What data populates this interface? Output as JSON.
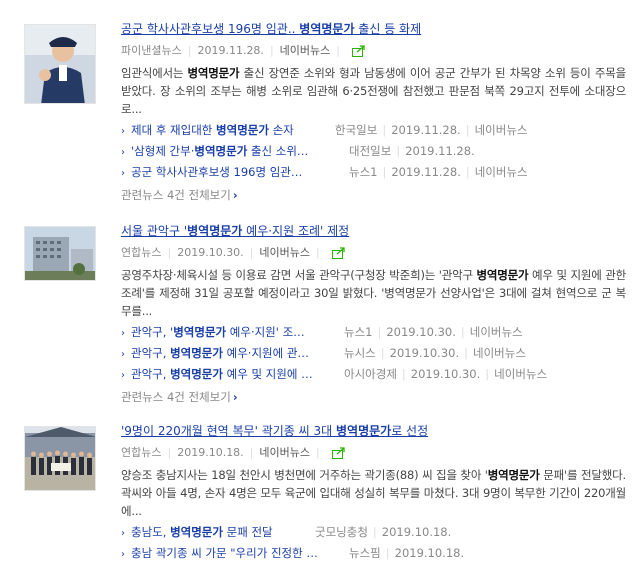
{
  "colors": {
    "link": "#1a3ea8",
    "meta": "#888888",
    "share": "#2db400"
  },
  "articles": [
    {
      "title_pre": "공군 학사사관후보생 196명 임관.. ",
      "title_hl": "병역명문가",
      "title_post": " 출신 등 화제",
      "source": "파이낸셜뉴스",
      "date": "2019.11.28.",
      "naver": "네이버뉴스",
      "desc_a": "임관식에서는 ",
      "desc_hl": "병역명문가",
      "desc_b": " 출신 장연준 소위와 형과 남동생에 이어 공군 간부가 된 차목양 소위 등이 주목을 받았다. 장 소위의 조부는 해병 소위로 임관해 6·25전쟁에 참전했고 판문점 북쪽 29고지 전투에 소대장으로...",
      "related": [
        {
          "pre": "제대 후 재입대한 ",
          "hl": "병역명문가",
          "post": " 손자",
          "source": "한국일보",
          "date": "2019.11.28.",
          "naver": "네이버뉴스"
        },
        {
          "pre": "'삼형제 간부·",
          "hl": "병역명문가",
          "post": " 출신 소위…",
          "source": "대전일보",
          "date": "2019.11.28.",
          "naver": ""
        },
        {
          "pre": "공군 학사사관후보생 196명 임관…",
          "hl": "",
          "post": "",
          "source": "뉴스1",
          "date": "2019.11.28.",
          "naver": "네이버뉴스"
        }
      ],
      "more": "관련뉴스 4건 전체보기"
    },
    {
      "title_pre": "서울 관악구 '",
      "title_hl": "병역명문가",
      "title_post": " 예우·지원 조례' 제정",
      "source": "연합뉴스",
      "date": "2019.10.30.",
      "naver": "네이버뉴스",
      "desc_a": "공영주차장·체육시설 등 이용료 감면 서울 관악구(구청장 박준희)는 '관악구 ",
      "desc_hl": "병역명문가",
      "desc_b": " 예우 및 지원에 관한 조례'를 제정해 31일 공포할 예정이라고 30일 밝혔다. '병역명문가 선양사업'은 3대에 걸쳐 현역으로 군 복무를...",
      "related": [
        {
          "pre": "관악구, '",
          "hl": "병역명문가",
          "post": " 예우·지원' 조…",
          "source": "뉴스1",
          "date": "2019.10.30.",
          "naver": "네이버뉴스"
        },
        {
          "pre": "관악구, ",
          "hl": "병역명문가",
          "post": " 예우·지원에 관…",
          "source": "뉴시스",
          "date": "2019.10.30.",
          "naver": "네이버뉴스"
        },
        {
          "pre": "관악구, ",
          "hl": "병역명문가",
          "post": " 예우 및 지원에 …",
          "source": "아시아경제",
          "date": "2019.10.30.",
          "naver": "네이버뉴스"
        }
      ],
      "more": "관련뉴스 4건 전체보기"
    },
    {
      "title_pre": "'9명이 220개월 현역 복무' 곽기종 씨 3대 ",
      "title_hl": "병역명문가",
      "title_post": "로 선정",
      "source": "연합뉴스",
      "date": "2019.10.18.",
      "naver": "네이버뉴스",
      "desc_a": "양승조 충남지사는 18일 천안시 병천면에 거주하는 곽기종(88) 씨 집을 찾아 '",
      "desc_hl": "병역명문가",
      "desc_b": " 문패'를 전달했다. 곽씨와 아들 4명, 손자 4명은 모두 육군에 입대해 성실히 복무를 마쳤다. 3대 9명이 복무한 기간이 220개월에...",
      "related": [
        {
          "pre": "충남도, ",
          "hl": "병역명문가",
          "post": " 문패 전달",
          "source": "굿모닝충청",
          "date": "2019.10.18.",
          "naver": ""
        },
        {
          "pre": "충남 곽기종 씨 가문 \"우리가 진정한 …",
          "hl": "",
          "post": "",
          "source": "뉴스핌",
          "date": "2019.10.18.",
          "naver": ""
        }
      ],
      "more": ""
    }
  ]
}
